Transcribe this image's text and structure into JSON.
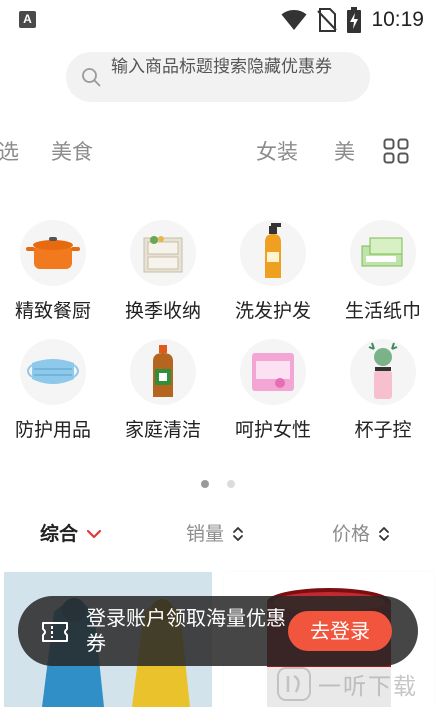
{
  "status_bar": {
    "notification_letter": "A",
    "time": "10:19",
    "icons": [
      "wifi-icon",
      "no-sim-icon",
      "battery-charging-icon"
    ]
  },
  "search": {
    "placeholder": "输入商品标题搜索隐藏优惠券",
    "icon": "search-icon"
  },
  "category_tabs": [
    {
      "label": "选"
    },
    {
      "label": "美食"
    },
    {
      "label": "女装"
    },
    {
      "label": "美"
    }
  ],
  "category_menu_icon": "grid-menu-icon",
  "grid_items": [
    {
      "label": "精致餐厨",
      "icon": "cooking-pot-icon"
    },
    {
      "label": "换季收纳",
      "icon": "storage-box-icon"
    },
    {
      "label": "洗发护发",
      "icon": "shampoo-bottle-icon"
    },
    {
      "label": "生活纸巾",
      "icon": "tissue-box-icon"
    },
    {
      "label": "防护用品",
      "icon": "face-mask-icon"
    },
    {
      "label": "家庭清洁",
      "icon": "disinfectant-bottle-icon"
    },
    {
      "label": "呵护女性",
      "icon": "sanitary-pad-icon"
    },
    {
      "label": "杯子控",
      "icon": "deer-cup-icon"
    }
  ],
  "pager": {
    "active_index": 0,
    "count": 2
  },
  "sort_bar": {
    "composite": "综合",
    "sales": "销量",
    "price": "价格"
  },
  "login_banner": {
    "text": "登录账户领取海量优惠券",
    "button": "去登录",
    "icon": "ticket-icon"
  },
  "watermark": {
    "text": "一听下载"
  },
  "colors": {
    "accent": "#f2553d",
    "sort_active_arrow": "#e03a3a",
    "banner_bg": "#282828"
  }
}
